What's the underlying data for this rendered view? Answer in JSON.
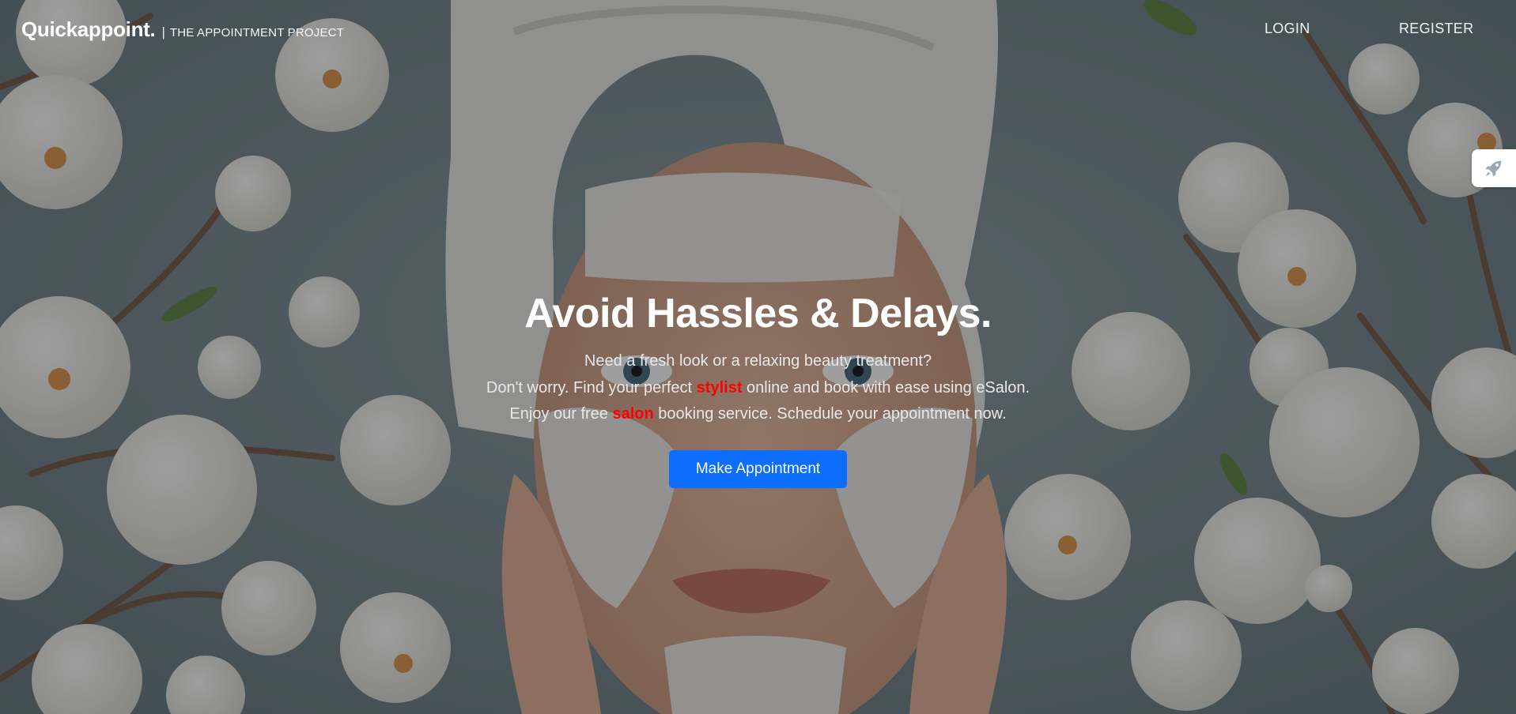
{
  "header": {
    "brand_name": "Quickappoint.",
    "brand_separator": "|",
    "brand_tagline": "THE APPOINTMENT PROJECT",
    "nav": {
      "login": "LOGIN",
      "register": "REGISTER"
    }
  },
  "side_widget": {
    "icon": "rocket-icon"
  },
  "hero": {
    "headline": "Avoid Hassles & Delays.",
    "line1": "Need a fresh look or a relaxing beauty treatment?",
    "line2_before": "Don't worry. Find your perfect ",
    "line2_highlight": "stylist",
    "line2_after": " online and book with ease using eSalon.",
    "line3_before": "Enjoy our free ",
    "line3_highlight": "salon",
    "line3_after": " booking service. Schedule your appointment now.",
    "cta_label": "Make Appointment"
  },
  "colors": {
    "accent": "#0d6efd",
    "highlight": "#ff0000",
    "text": "#ffffff"
  }
}
